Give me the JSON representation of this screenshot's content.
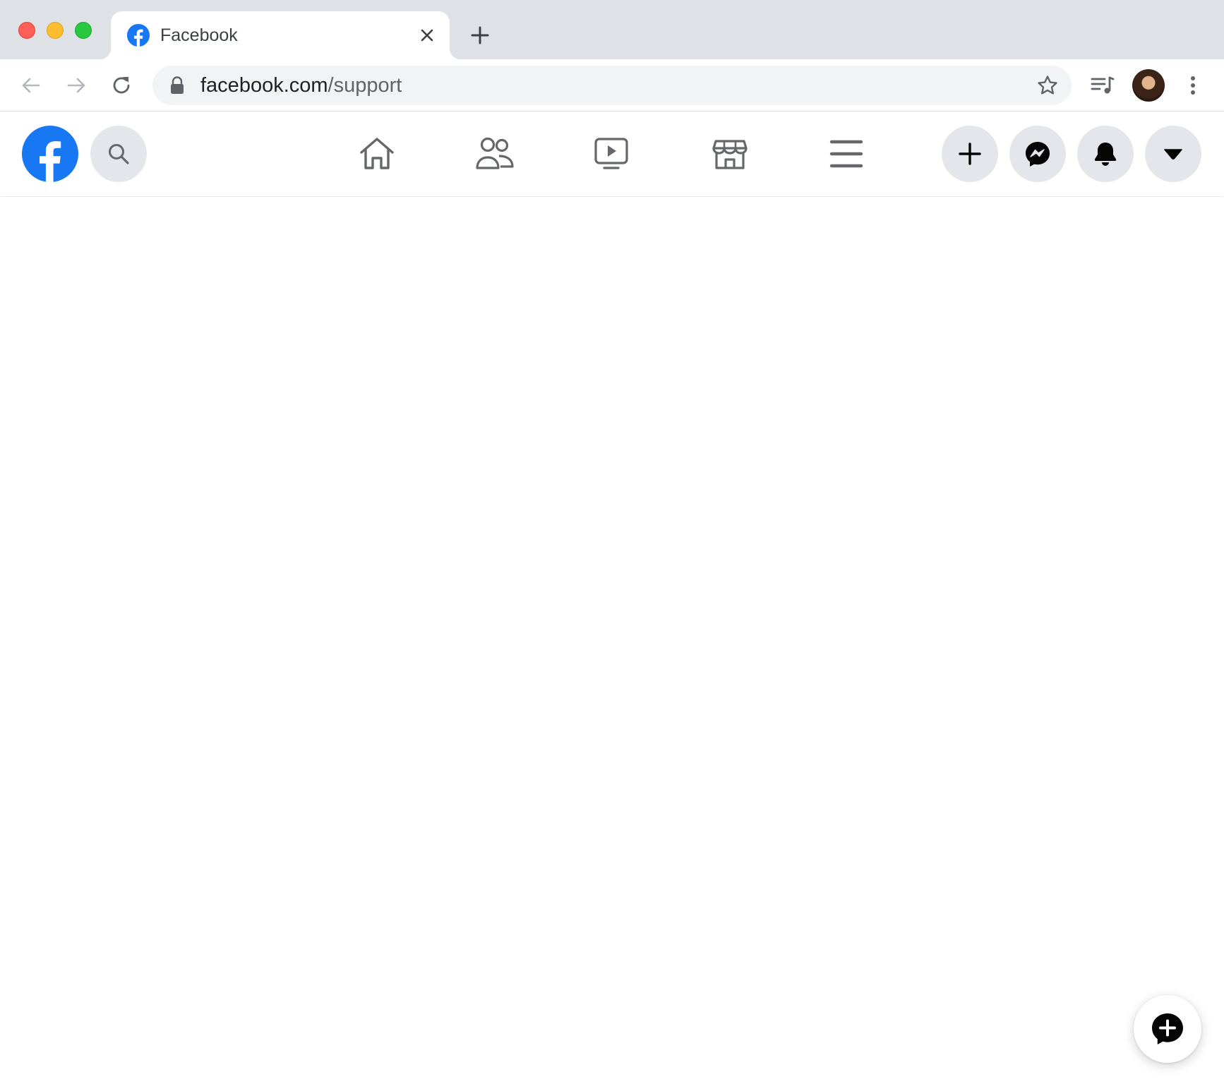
{
  "browser": {
    "tab": {
      "title": "Facebook"
    },
    "address_bar": {
      "host": "facebook.com",
      "path": "/support"
    }
  },
  "facebook": {
    "nav": [
      {
        "icon": "home-icon",
        "label": "Home"
      },
      {
        "icon": "friends-icon",
        "label": "Friends"
      },
      {
        "icon": "watch-icon",
        "label": "Watch"
      },
      {
        "icon": "marketplace-icon",
        "label": "Marketplace"
      },
      {
        "icon": "menu-icon",
        "label": "Menu"
      }
    ],
    "actions": [
      "create-icon",
      "messenger-icon",
      "notifications-icon",
      "account-caret-icon"
    ],
    "brand_color": "#1877f2"
  }
}
